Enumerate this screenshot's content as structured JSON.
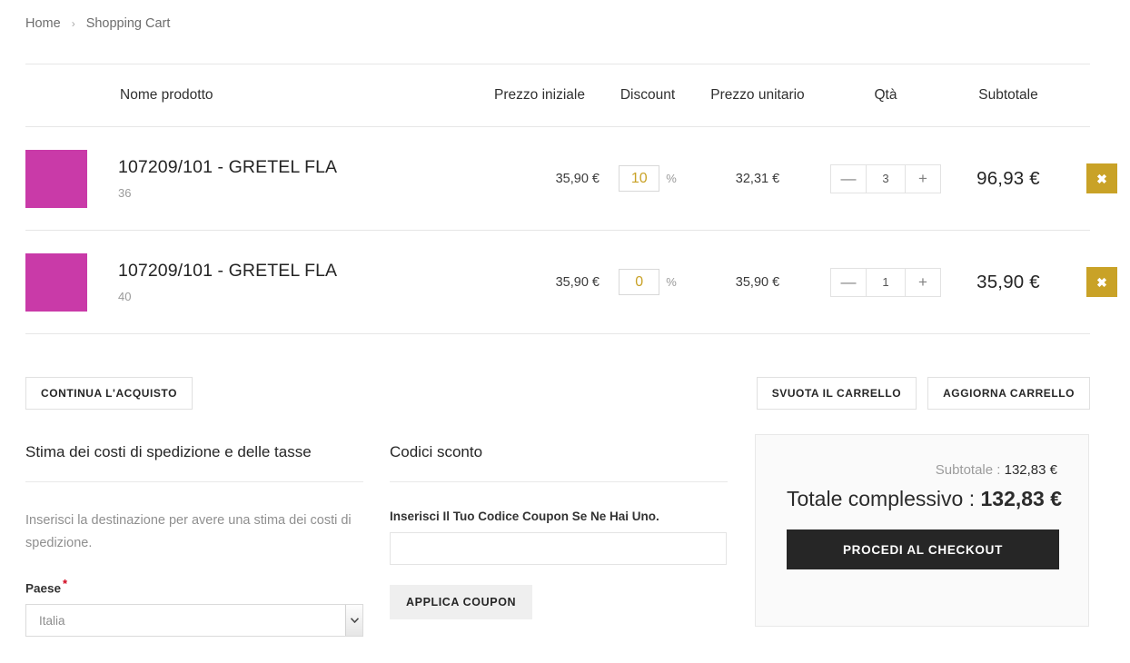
{
  "breadcrumb": {
    "home": "Home",
    "separator": "›",
    "current": "Shopping Cart"
  },
  "table": {
    "headers": {
      "product": "Nome prodotto",
      "initial_price": "Prezzo iniziale",
      "discount": "Discount",
      "unit_price": "Prezzo unitario",
      "qty": "Qtà",
      "subtotal": "Subtotale"
    },
    "rows": [
      {
        "name": "107209/101 - GRETEL FLA",
        "variant": "36",
        "initial_price": "35,90 €",
        "discount": "10",
        "discount_unit": "%",
        "unit_price": "32,31 €",
        "qty": "3",
        "subtotal": "96,93 €",
        "minus": "—",
        "plus": "+",
        "remove": "✖",
        "thumb_color": "#c93aa8"
      },
      {
        "name": "107209/101 - GRETEL FLA",
        "variant": "40",
        "initial_price": "35,90 €",
        "discount": "0",
        "discount_unit": "%",
        "unit_price": "35,90 €",
        "qty": "1",
        "subtotal": "35,90 €",
        "minus": "—",
        "plus": "+",
        "remove": "✖",
        "thumb_color": "#c93aa8"
      }
    ]
  },
  "actions": {
    "continue_shopping": "CONTINUA L'ACQUISTO",
    "empty_cart": "SVUOTA IL CARRELLO",
    "update_cart": "AGGIORNA CARRELLO"
  },
  "shipping": {
    "title": "Stima dei costi di spedizione e delle tasse",
    "description": "Inserisci la destinazione per avere una stima dei costi di spedizione.",
    "country_label": "Paese",
    "required_mark": "*",
    "country_value": "Italia"
  },
  "coupon": {
    "title": "Codici sconto",
    "hint": "Inserisci Il Tuo Codice Coupon Se Ne Hai Uno.",
    "value": "",
    "placeholder": "",
    "apply_label": "APPLICA COUPON"
  },
  "summary": {
    "subtotal_label": "Subtotale :",
    "subtotal_value": "132,83 €",
    "total_label": "Totale complessivo :",
    "total_value": "132,83 €",
    "checkout_label": "PROCEDI AL CHECKOUT"
  },
  "colors": {
    "accent_gold": "#c9a227",
    "thumb_magenta": "#c93aa8",
    "checkout_dark": "#262626"
  }
}
